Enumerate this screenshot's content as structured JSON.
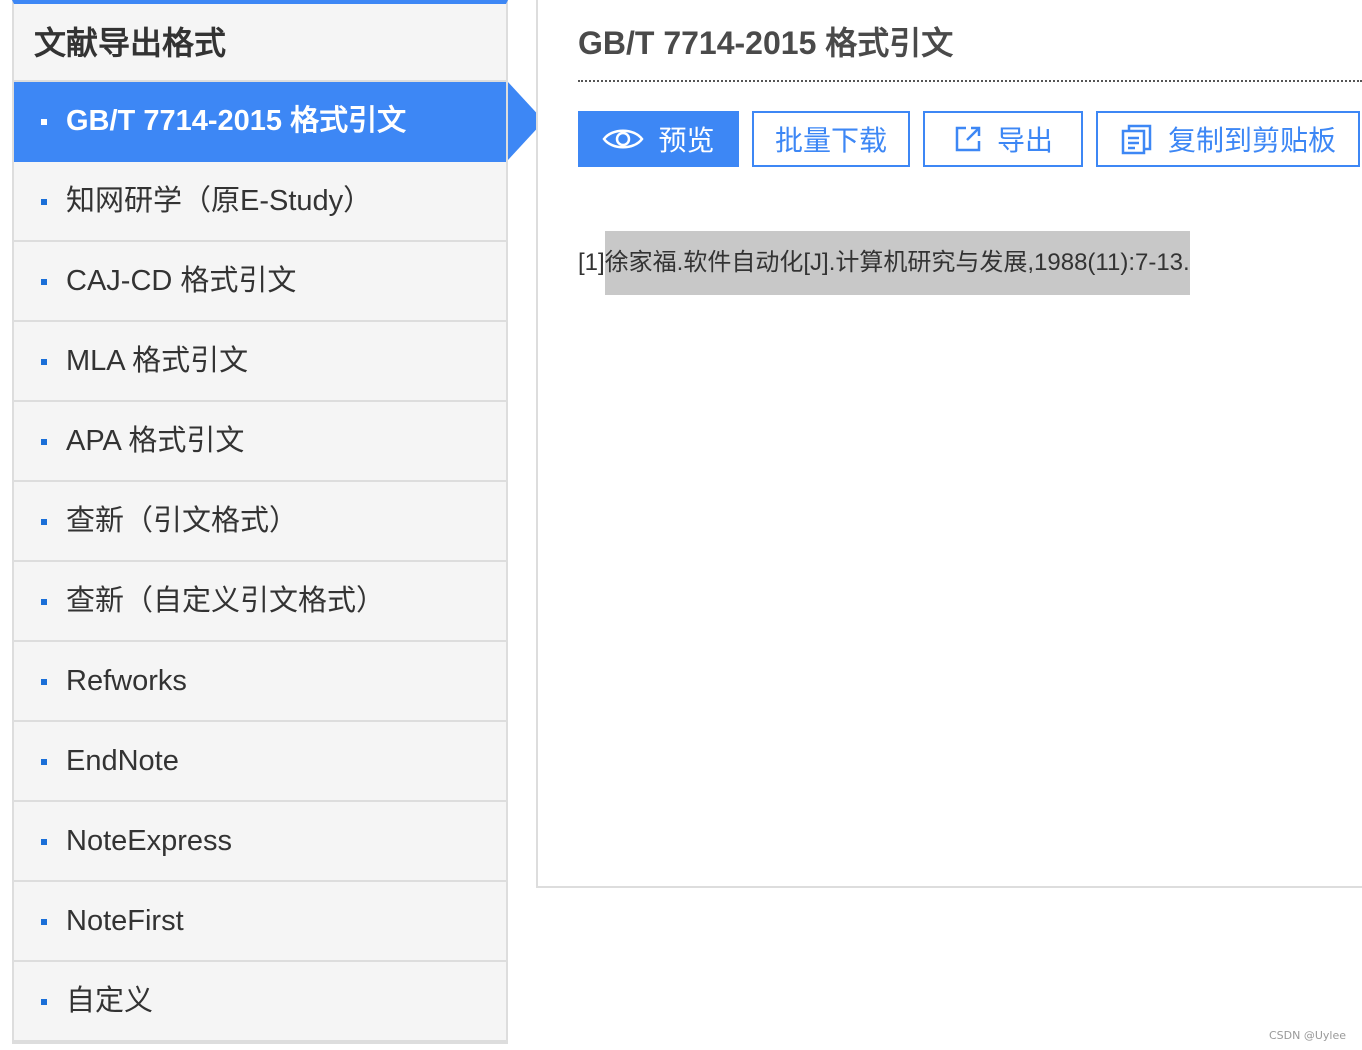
{
  "sidebar": {
    "title": "文献导出格式",
    "items": [
      {
        "label": "GB/T 7714-2015 格式引文",
        "active": true
      },
      {
        "label": "知网研学（原E-Study）",
        "active": false
      },
      {
        "label": "CAJ-CD 格式引文",
        "active": false
      },
      {
        "label": "MLA 格式引文",
        "active": false
      },
      {
        "label": "APA 格式引文",
        "active": false
      },
      {
        "label": "查新（引文格式）",
        "active": false
      },
      {
        "label": "查新（自定义引文格式）",
        "active": false
      },
      {
        "label": "Refworks",
        "active": false
      },
      {
        "label": "EndNote",
        "active": false
      },
      {
        "label": "NoteExpress",
        "active": false
      },
      {
        "label": "NoteFirst",
        "active": false
      },
      {
        "label": "自定义",
        "active": false
      }
    ]
  },
  "main": {
    "title": "GB/T 7714-2015 格式引文",
    "toolbar": {
      "preview": {
        "label": "预览",
        "icon": "eye-icon"
      },
      "batch_download": {
        "label": "批量下载"
      },
      "export": {
        "label": "导出",
        "icon": "export-icon"
      },
      "copy": {
        "label": "复制到剪贴板",
        "icon": "clipboard-icon"
      }
    },
    "citation": {
      "index": "[1]",
      "text": "徐家福.软件自动化[J].计算机研究与发展,1988(11):7-13."
    }
  },
  "watermark": "CSDN @Uylee",
  "colors": {
    "accent": "#3d87f5",
    "sidebar_bg": "#f5f5f5",
    "highlight": "#c8c8c8"
  }
}
